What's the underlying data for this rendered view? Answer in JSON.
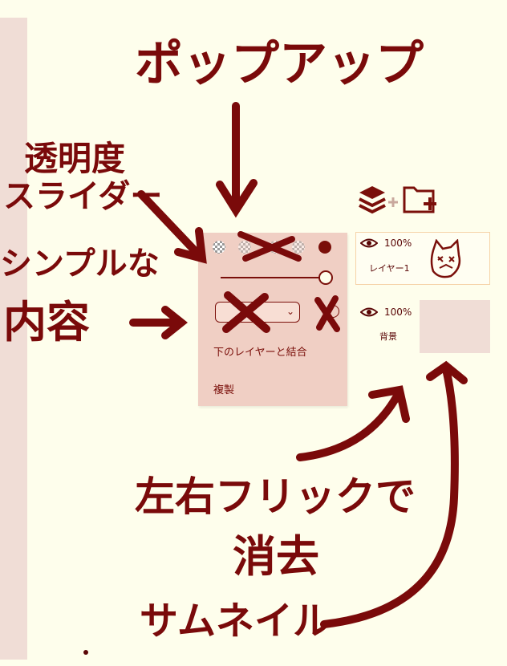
{
  "popup": {
    "menu_items": [
      "下のレイヤーと結合",
      "複製"
    ]
  },
  "layers": [
    {
      "opacity": "100%",
      "name": "レイヤー1",
      "selected": true
    },
    {
      "opacity": "100%",
      "name": "背景",
      "selected": false
    }
  ],
  "annotations": {
    "popup": "ポップアップ",
    "opacity_slider": [
      "透明度",
      "スライダー"
    ],
    "simple_contents": [
      "シンプルな",
      "内容"
    ],
    "flick_delete": [
      "左右フリックで",
      "消去"
    ],
    "thumbnail": "サムネイル"
  },
  "colors": {
    "background": "#fefeec",
    "popup_bg": "#f0cfc4",
    "accent": "#7a0f0a",
    "thumb_bg": "#f0ddd6",
    "selected_border": "#f6d3a8"
  },
  "icons": {
    "layers": "layers-add-icon",
    "folder": "folder-add-icon",
    "eye": "eye-icon"
  }
}
